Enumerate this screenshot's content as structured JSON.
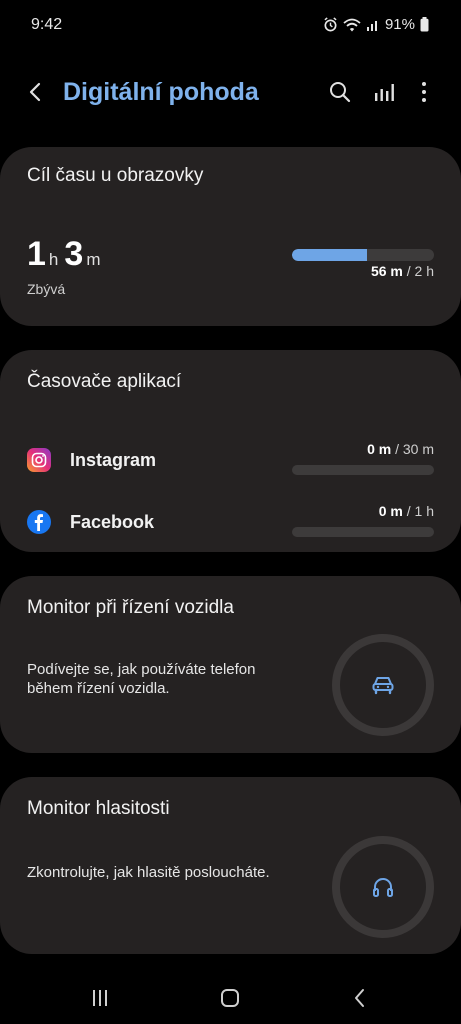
{
  "status_bar": {
    "time": "9:42",
    "battery": "91%",
    "icons": [
      "alarm-icon",
      "wifi-icon",
      "signal-icon",
      "battery-icon"
    ]
  },
  "app_bar": {
    "title": "Digitální pohoda",
    "back_icon": "chevron-left-icon",
    "actions": [
      "search-icon",
      "bar-chart-icon",
      "more-vertical-icon"
    ],
    "accent_color": "#7fb2ec"
  },
  "screen_time_goal": {
    "title": "Cíl času u obrazovky",
    "hours": "1",
    "hours_unit": "h",
    "minutes": "3",
    "minutes_unit": "m",
    "remaining_label": "Zbývá",
    "used": "56 m",
    "goal": "/ 2 h",
    "progress_fraction": 0.53,
    "progress_color": "#6ea5e6"
  },
  "app_timers": {
    "title": "Časovače aplikací",
    "apps": [
      {
        "name": "Instagram",
        "icon": "instagram-icon",
        "used": "0 m",
        "limit": "/ 30 m",
        "progress_fraction": 0
      },
      {
        "name": "Facebook",
        "icon": "facebook-icon",
        "used": "0 m",
        "limit": "/ 1 h",
        "progress_fraction": 0
      }
    ]
  },
  "driving_monitor": {
    "title": "Monitor při řízení vozidla",
    "description": "Podívejte se, jak používáte telefon během řízení vozidla.",
    "icon": "car-icon"
  },
  "volume_monitor": {
    "title": "Monitor hlasitosti",
    "description": "Zkontrolujte, jak hlasitě posloucháte.",
    "icon": "headphones-icon"
  },
  "nav_bar": {
    "buttons": [
      "recents-icon",
      "home-icon",
      "back-icon"
    ]
  }
}
